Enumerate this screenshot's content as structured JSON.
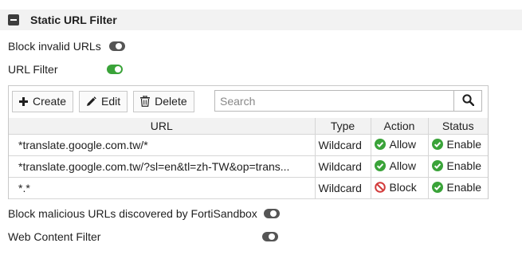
{
  "section": {
    "title": "Static URL Filter"
  },
  "options": {
    "block_invalid_urls": {
      "label": "Block invalid URLs",
      "enabled": false
    },
    "url_filter": {
      "label": "URL Filter",
      "enabled": true
    },
    "block_malicious": {
      "label": "Block malicious URLs discovered by FortiSandbox",
      "enabled": false
    },
    "web_content_filter": {
      "label": "Web Content Filter",
      "enabled": false
    }
  },
  "toolbar": {
    "create_label": "Create",
    "edit_label": "Edit",
    "delete_label": "Delete",
    "search_placeholder": "Search"
  },
  "table": {
    "columns": [
      "URL",
      "Type",
      "Action",
      "Status"
    ],
    "rows": [
      {
        "url": "*translate.google.com.tw/*",
        "type": "Wildcard",
        "action": "Allow",
        "status": "Enable"
      },
      {
        "url": "*translate.google.com.tw/?sl=en&tl=zh-TW&op=trans...",
        "type": "Wildcard",
        "action": "Allow",
        "status": "Enable"
      },
      {
        "url": "*.*",
        "type": "Wildcard",
        "action": "Block",
        "status": "Enable"
      }
    ]
  },
  "colors": {
    "toggle_on": "#3aa339",
    "toggle_off": "#555555",
    "allow": "#3aa339",
    "block": "#d23b3b",
    "header_bg": "#f2f2f2"
  }
}
